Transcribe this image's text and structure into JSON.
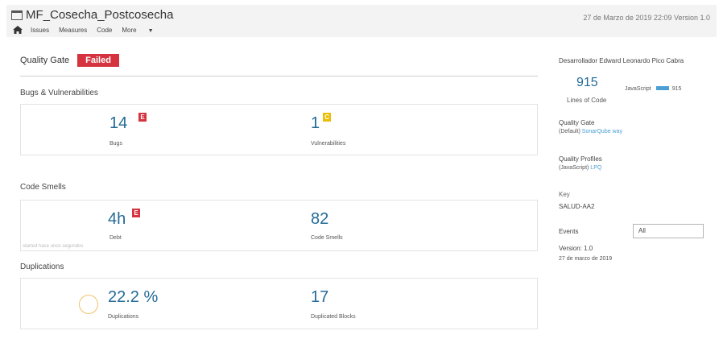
{
  "header": {
    "title": "MF_Cosecha_Postcosecha",
    "date_version": "27 de Marzo de 2019 22:09 Version 1.0",
    "nav": {
      "issues": "Issues",
      "measures": "Measures",
      "code": "Code",
      "more": "More"
    }
  },
  "quality_gate": {
    "label": "Quality Gate",
    "status": "Failed"
  },
  "bugs_vulns": {
    "title": "Bugs & Vulnerabilities",
    "bugs": {
      "value": "14",
      "rating": "E",
      "label": "Bugs"
    },
    "vulnerabilities": {
      "value": "1",
      "rating": "C",
      "label": "Vulnerabilities"
    }
  },
  "code_smells": {
    "title": "Code Smells",
    "debt": {
      "value": "4h",
      "rating": "E",
      "label": "Debt"
    },
    "smells": {
      "value": "82",
      "label": "Code Smells"
    },
    "started": "started hace unos segundos"
  },
  "duplications": {
    "title": "Duplications",
    "density": {
      "value": "22.2 %",
      "label": "Duplications"
    },
    "blocks": {
      "value": "17",
      "label": "Duplicated Blocks"
    }
  },
  "sidebar": {
    "developer": "Desarrollador Edward Leonardo Pico Cabra",
    "lines_of_code": {
      "value": "915",
      "label": "Lines of Code"
    },
    "language": {
      "name": "JavaScript",
      "value": "915"
    },
    "quality_gate": {
      "title": "Quality Gate",
      "prefix": "(Default)",
      "link": "SonarQube way"
    },
    "quality_profiles": {
      "title": "Quality Profiles",
      "prefix": "(JavaScript)",
      "link": "LPQ"
    },
    "key": {
      "title": "Key",
      "value": "SALUD-AA2"
    },
    "events": {
      "title": "Events",
      "filter": "All",
      "version": "Version: 1.0",
      "date": "27 de marzo de 2019"
    }
  },
  "colors": {
    "accent": "#236a97",
    "failed": "#d4333f",
    "rating_e": "#d4333f",
    "rating_c": "#eabe06",
    "link": "#4b9fd5"
  }
}
